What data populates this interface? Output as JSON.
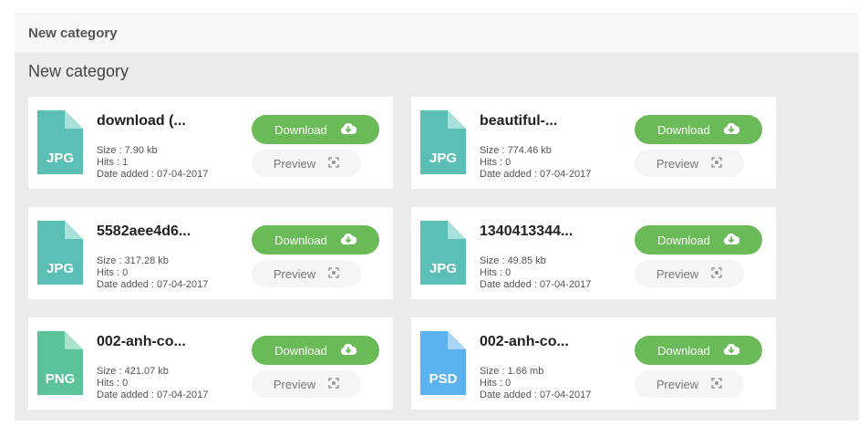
{
  "header": {
    "title": "New category"
  },
  "category": {
    "heading": "New category"
  },
  "files": [
    {
      "name": "download (...",
      "ext": "JPG",
      "color": "#5bbfb5",
      "fold": "#a8e0da",
      "size": "Size : 7.90 kb",
      "hits": "Hits : 1",
      "date": "Date added : 07-04-2017",
      "download_label": "Download",
      "preview_label": "Preview"
    },
    {
      "name": "beautiful-...",
      "ext": "JPG",
      "color": "#5bbfb5",
      "fold": "#a8e0da",
      "size": "Size : 774.46 kb",
      "hits": "Hits : 0",
      "date": "Date added : 07-04-2017",
      "download_label": "Download",
      "preview_label": "Preview"
    },
    {
      "name": "5582aee4d6...",
      "ext": "JPG",
      "color": "#5bbfb5",
      "fold": "#a8e0da",
      "size": "Size : 317.28 kb",
      "hits": "Hits : 0",
      "date": "Date added : 07-04-2017",
      "download_label": "Download",
      "preview_label": "Preview"
    },
    {
      "name": "1340413344...",
      "ext": "JPG",
      "color": "#5bbfb5",
      "fold": "#a8e0da",
      "size": "Size : 49.85 kb",
      "hits": "Hits : 0",
      "date": "Date added : 07-04-2017",
      "download_label": "Download",
      "preview_label": "Preview"
    },
    {
      "name": "002-anh-co...",
      "ext": "PNG",
      "color": "#5cc29a",
      "fold": "#a9e3cb",
      "size": "Size : 421.07 kb",
      "hits": "Hits : 0",
      "date": "Date added : 07-04-2017",
      "download_label": "Download",
      "preview_label": "Preview"
    },
    {
      "name": "002-anh-co...",
      "ext": "PSD",
      "color": "#5cb2ee",
      "fold": "#a9d6f7",
      "size": "Size : 1.66 mb",
      "hits": "Hits : 0",
      "date": "Date added : 07-04-2017",
      "download_label": "Download",
      "preview_label": "Preview"
    }
  ],
  "colors": {
    "download_button": "#6abb57",
    "preview_button": "#f5f5f5"
  }
}
